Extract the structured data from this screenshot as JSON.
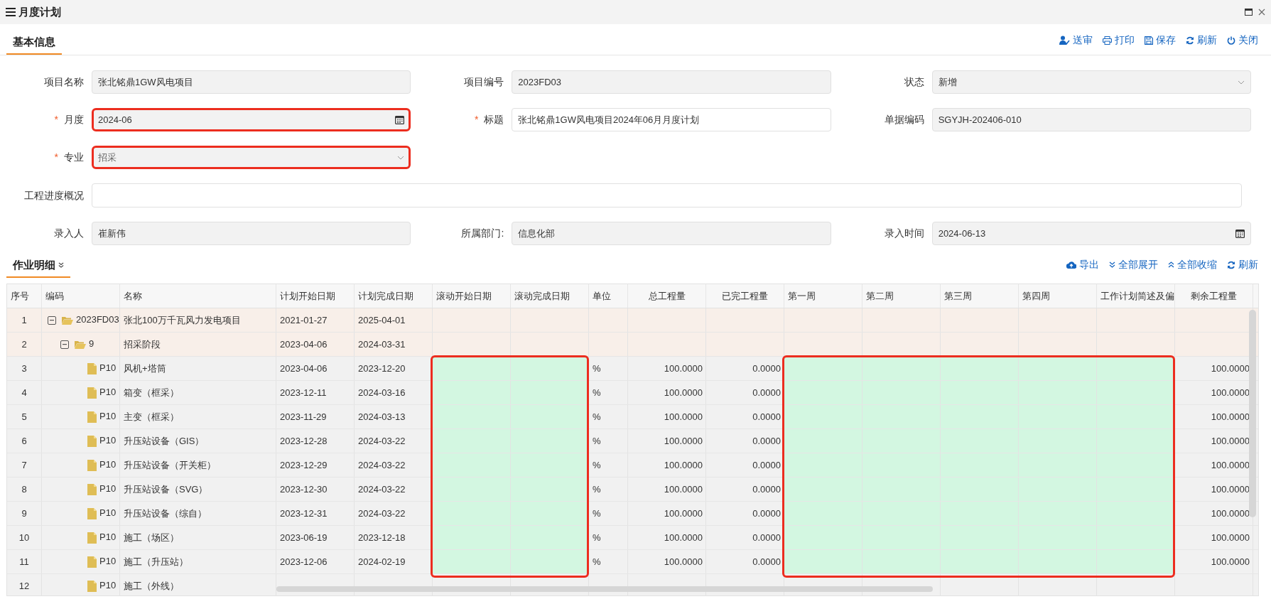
{
  "window": {
    "title": "月度计划"
  },
  "tabs": [
    {
      "label": "基本信息",
      "selected": true
    }
  ],
  "toolbar": [
    {
      "kind": "submit",
      "label": "送审"
    },
    {
      "kind": "print",
      "label": "打印"
    },
    {
      "kind": "save",
      "label": "保存"
    },
    {
      "kind": "refresh",
      "label": "刷新"
    },
    {
      "kind": "close",
      "label": "关闭"
    }
  ],
  "form": {
    "fields": [
      {
        "label": "项目名称",
        "value": "张北铭鼎1GW风电项目",
        "kind": "text",
        "disabled": true,
        "highlighted": false
      },
      {
        "label": "项目编号",
        "value": "2023FD03",
        "kind": "text",
        "disabled": true,
        "highlighted": false
      },
      {
        "label": "状态",
        "value": "新增",
        "kind": "select",
        "disabled": true,
        "highlighted": false
      },
      {
        "label": "月度",
        "value": "2024-06",
        "kind": "date",
        "disabled": true,
        "required_mark": "*",
        "highlighted": true
      },
      {
        "label": "标题",
        "value": "张北铭鼎1GW风电项目2024年06月月度计划",
        "kind": "text",
        "disabled": false,
        "required_mark": "*",
        "highlighted": false
      },
      {
        "label": "单据编码",
        "value": "SGYJH-202406-010",
        "kind": "text",
        "disabled": true,
        "highlighted": false
      },
      {
        "label": "专业",
        "value": "招采",
        "kind": "select",
        "disabled": true,
        "required_mark": "*",
        "highlighted": true
      },
      {
        "label": "工程进度概况",
        "kind": "wide",
        "disabled": false,
        "highlighted": false
      },
      {
        "label": "录入人",
        "value": "崔新伟",
        "kind": "text",
        "disabled": true,
        "highlighted": false
      },
      {
        "label": "所属部门:",
        "value": "信息化部",
        "kind": "text",
        "disabled": true,
        "highlighted": false
      },
      {
        "label": "录入时间",
        "value": "2024-06-13",
        "kind": "date",
        "disabled": true,
        "highlighted": false
      }
    ]
  },
  "detail": {
    "tab": {
      "label": "作业明细",
      "selected": true
    },
    "toolbar": [
      {
        "kind": "export",
        "label": "导出"
      },
      {
        "kind": "expand",
        "label": "全部展开"
      },
      {
        "kind": "collapse",
        "label": "全部收缩"
      },
      {
        "kind": "refresh",
        "label": "刷新"
      }
    ],
    "table": {
      "columns": [
        {
          "label": "序号",
          "kind": "text",
          "highlighted": false
        },
        {
          "label": "编码",
          "kind": "text",
          "highlighted": false
        },
        {
          "label": "名称",
          "kind": "text",
          "highlighted": false
        },
        {
          "label": "计划开始日期",
          "kind": "text",
          "highlighted": false
        },
        {
          "label": "计划完成日期",
          "kind": "text",
          "highlighted": false
        },
        {
          "label": "滚动开始日期",
          "kind": "text",
          "highlighted": true
        },
        {
          "label": "滚动完成日期",
          "kind": "text",
          "highlighted": true
        },
        {
          "label": "单位",
          "kind": "text",
          "highlighted": false
        },
        {
          "label": "总工程量",
          "kind": "number",
          "highlighted": false
        },
        {
          "label": "已完工程量",
          "kind": "number",
          "highlighted": false
        },
        {
          "label": "第一周",
          "kind": "text",
          "highlighted": true
        },
        {
          "label": "第二周",
          "kind": "text",
          "highlighted": true
        },
        {
          "label": "第三周",
          "kind": "text",
          "highlighted": true
        },
        {
          "label": "第四周",
          "kind": "text",
          "highlighted": true
        },
        {
          "label": "工作计划简述及偏",
          "kind": "text",
          "highlighted": true
        },
        {
          "label": "剩余工程量",
          "kind": "number",
          "highlighted": false
        }
      ],
      "rows": [
        {
          "seq": "1",
          "code": "2023FD03",
          "name": "张北100万千瓦风力发电项目",
          "plan_start": "2021-01-27",
          "plan_end": "2025-04-01",
          "expanded": true,
          "editable": false,
          "highlighted": false,
          "children": [
            {
              "seq": "2",
              "code": "9",
              "name": "招采阶段",
              "plan_start": "2023-04-06",
              "plan_end": "2024-03-31",
              "expanded": true,
              "editable": false,
              "highlighted": false,
              "children": [
                {
                  "seq": "3",
                  "code": "P10",
                  "name": "风机+塔筒",
                  "plan_start": "2023-04-06",
                  "plan_end": "2023-12-20",
                  "unit": "%",
                  "total": "100.0000",
                  "done": "0.0000",
                  "remaining": "100.0000",
                  "editable": true,
                  "highlighted": true
                },
                {
                  "seq": "4",
                  "code": "P10",
                  "name": "箱变（框采）",
                  "plan_start": "2023-12-11",
                  "plan_end": "2024-03-16",
                  "unit": "%",
                  "total": "100.0000",
                  "done": "0.0000",
                  "remaining": "100.0000",
                  "editable": true,
                  "highlighted": true
                },
                {
                  "seq": "5",
                  "code": "P10",
                  "name": "主变（框采）",
                  "plan_start": "2023-11-29",
                  "plan_end": "2024-03-13",
                  "unit": "%",
                  "total": "100.0000",
                  "done": "0.0000",
                  "remaining": "100.0000",
                  "editable": true,
                  "highlighted": true
                },
                {
                  "seq": "6",
                  "code": "P10",
                  "name": "升压站设备（GIS）",
                  "plan_start": "2023-12-28",
                  "plan_end": "2024-03-22",
                  "unit": "%",
                  "total": "100.0000",
                  "done": "0.0000",
                  "remaining": "100.0000",
                  "editable": true,
                  "highlighted": true
                },
                {
                  "seq": "7",
                  "code": "P10",
                  "name": "升压站设备（开关柜）",
                  "plan_start": "2023-12-29",
                  "plan_end": "2024-03-22",
                  "unit": "%",
                  "total": "100.0000",
                  "done": "0.0000",
                  "remaining": "100.0000",
                  "editable": true,
                  "highlighted": true
                },
                {
                  "seq": "8",
                  "code": "P10",
                  "name": "升压站设备（SVG）",
                  "plan_start": "2023-12-30",
                  "plan_end": "2024-03-22",
                  "unit": "%",
                  "total": "100.0000",
                  "done": "0.0000",
                  "remaining": "100.0000",
                  "editable": true,
                  "highlighted": true
                },
                {
                  "seq": "9",
                  "code": "P10",
                  "name": "升压站设备（综自）",
                  "plan_start": "2023-12-31",
                  "plan_end": "2024-03-22",
                  "unit": "%",
                  "total": "100.0000",
                  "done": "0.0000",
                  "remaining": "100.0000",
                  "editable": true,
                  "highlighted": true
                },
                {
                  "seq": "10",
                  "code": "P10",
                  "name": "施工（场区）",
                  "plan_start": "2023-06-19",
                  "plan_end": "2023-12-18",
                  "unit": "%",
                  "total": "100.0000",
                  "done": "0.0000",
                  "remaining": "100.0000",
                  "editable": true,
                  "highlighted": true
                },
                {
                  "seq": "11",
                  "code": "P10",
                  "name": "施工（升压站）",
                  "plan_start": "2023-12-06",
                  "plan_end": "2024-02-19",
                  "unit": "%",
                  "total": "100.0000",
                  "done": "0.0000",
                  "remaining": "100.0000",
                  "editable": true,
                  "highlighted": true
                },
                {
                  "seq": "12",
                  "code": "P10",
                  "name": "施工（外线）",
                  "editable": false,
                  "highlighted": false
                }
              ]
            }
          ]
        }
      ]
    }
  }
}
